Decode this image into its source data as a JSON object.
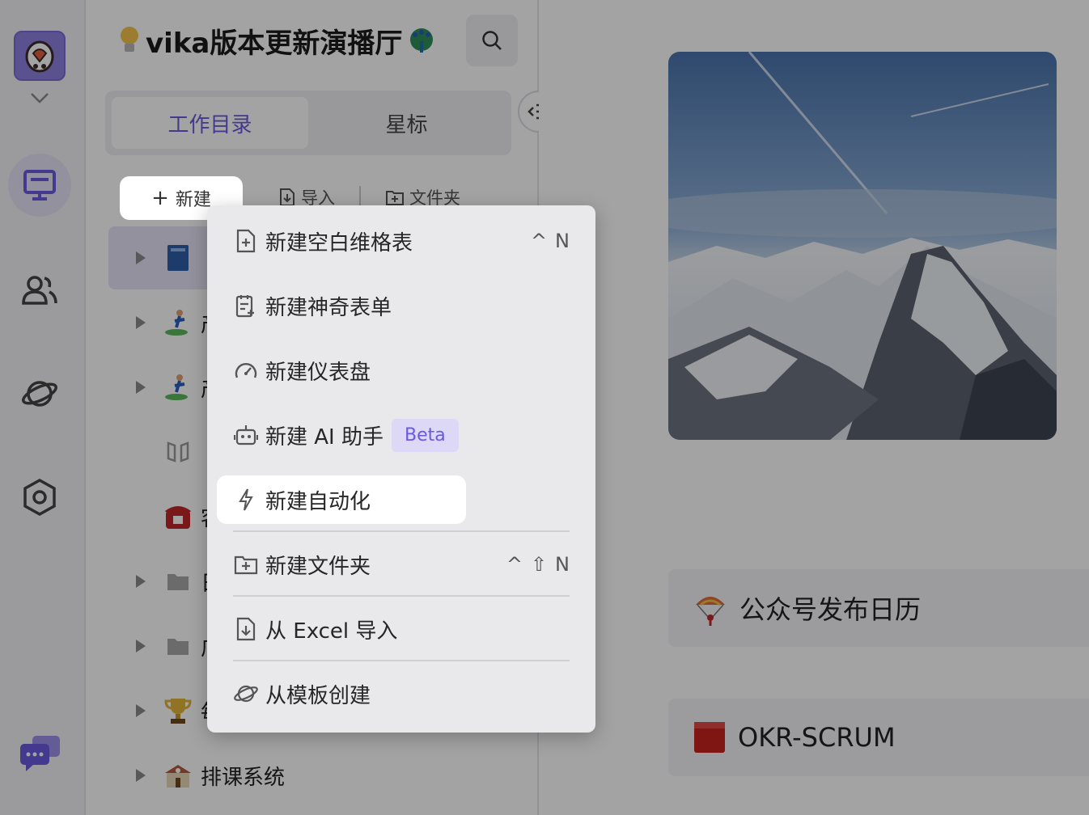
{
  "space": {
    "title": "vika版本更新演播厅"
  },
  "tabs": [
    {
      "label": "工作目录"
    },
    {
      "label": "星标"
    }
  ],
  "toolbar": {
    "new_label": "新建",
    "import_label": "导入",
    "folder_label": "文件夹"
  },
  "tree": [
    {
      "label": "",
      "icon": "book-icon"
    },
    {
      "label": "产",
      "icon": "surfer-icon"
    },
    {
      "label": "产",
      "icon": "surfer-icon"
    },
    {
      "label": "",
      "icon": "layout-icon"
    },
    {
      "label": "客",
      "icon": "telephone-icon"
    },
    {
      "label": "日",
      "icon": "folder-icon"
    },
    {
      "label": "广",
      "icon": "folder-icon"
    },
    {
      "label": "每",
      "icon": "trophy-icon"
    },
    {
      "label": "排课系统",
      "icon": "school-icon"
    }
  ],
  "menu": {
    "items": [
      {
        "label": "新建空白维格表",
        "icon": "file-add-icon",
        "shortcut": [
          "^",
          "N"
        ]
      },
      {
        "label": "新建神奇表单",
        "icon": "form-icon"
      },
      {
        "label": "新建仪表盘",
        "icon": "dashboard-icon"
      },
      {
        "label": "新建 AI 助手",
        "icon": "robot-icon",
        "badge": "Beta"
      },
      {
        "label": "新建自动化",
        "icon": "lightning-icon"
      },
      {
        "label": "新建文件夹",
        "icon": "folder-add-icon",
        "shortcut": [
          "^",
          "⇧",
          "N"
        ]
      },
      {
        "label": "从 Excel 导入",
        "icon": "import-icon"
      },
      {
        "label": "从模板创建",
        "icon": "planet-icon"
      }
    ]
  },
  "cards": [
    {
      "label": "公众号发布日历",
      "icon": "parachute-icon"
    },
    {
      "label": "OKR-SCRUM",
      "icon": "red-square-icon"
    }
  ],
  "colors": {
    "accent": "#6a5ae0",
    "overlay": "rgba(0,0,0,0.36)"
  }
}
